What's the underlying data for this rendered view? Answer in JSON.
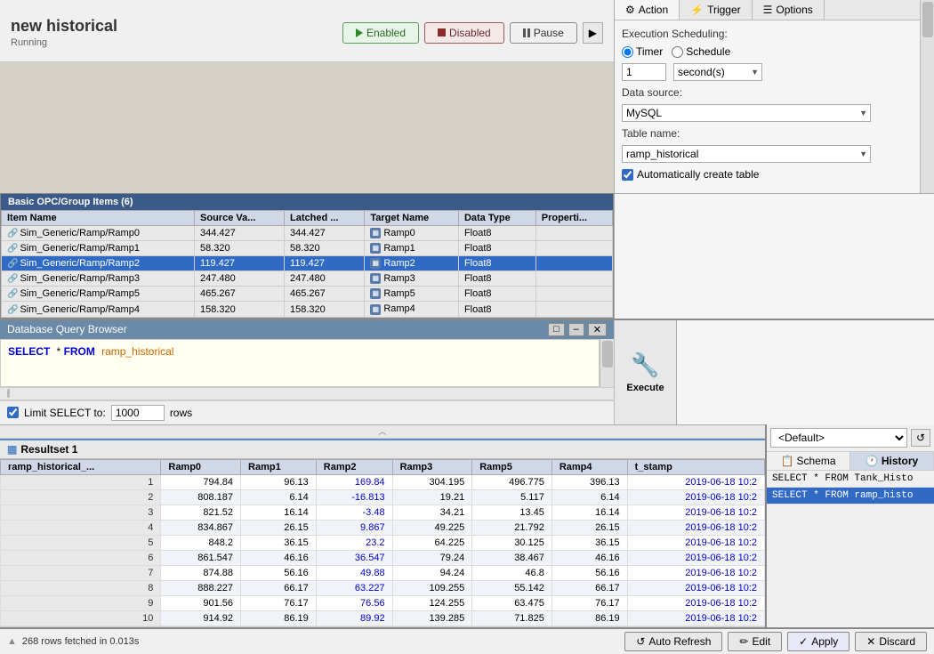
{
  "app": {
    "title": "new historical",
    "subtitle": "Running"
  },
  "toolbar": {
    "enabled_label": "Enabled",
    "disabled_label": "Disabled",
    "pause_label": "Pause",
    "arrow_btn_label": "▶"
  },
  "tabs": {
    "action": "Action",
    "trigger": "Trigger",
    "options": "Options"
  },
  "config": {
    "execution_label": "Execution Scheduling:",
    "timer_label": "Timer",
    "schedule_label": "Schedule",
    "timer_value": "1",
    "timer_unit": "second(s)",
    "datasource_label": "Data source:",
    "datasource_value": "MySQL",
    "tablename_label": "Table name:",
    "tablename_value": "ramp_historical",
    "autocreate_label": "Automatically create table"
  },
  "opc": {
    "header": "Basic OPC/Group Items (6)",
    "columns": [
      "Item Name",
      "Source Va...",
      "Latched ...",
      "Target Name",
      "Data Type",
      "Properti..."
    ],
    "rows": [
      {
        "name": "Sim_Generic/Ramp/Ramp0",
        "source": "344.427",
        "latched": "344.427",
        "target": "Ramp0",
        "dtype": "Float8",
        "props": "",
        "selected": false
      },
      {
        "name": "Sim_Generic/Ramp/Ramp1",
        "source": "58.320",
        "latched": "58.320",
        "target": "Ramp1",
        "dtype": "Float8",
        "props": "",
        "selected": false
      },
      {
        "name": "Sim_Generic/Ramp/Ramp2",
        "source": "119.427",
        "latched": "119.427",
        "target": "Ramp2",
        "dtype": "Float8",
        "props": "",
        "selected": true
      },
      {
        "name": "Sim_Generic/Ramp/Ramp3",
        "source": "247.480",
        "latched": "247.480",
        "target": "Ramp3",
        "dtype": "Float8",
        "props": "",
        "selected": false
      },
      {
        "name": "Sim_Generic/Ramp/Ramp5",
        "source": "465.267",
        "latched": "465.267",
        "target": "Ramp5",
        "dtype": "Float8",
        "props": "",
        "selected": false
      },
      {
        "name": "Sim_Generic/Ramp/Ramp4",
        "source": "158.320",
        "latched": "158.320",
        "target": "Ramp4",
        "dtype": "Float8",
        "props": "",
        "selected": false
      }
    ]
  },
  "db_browser": {
    "title": "Database Query Browser",
    "sql": "SELECT * FROM ramp_historical",
    "limit_label": "Limit SELECT to:",
    "limit_value": "1000",
    "rows_label": "rows"
  },
  "resultset": {
    "tab_label": "Resultset 1",
    "columns": [
      "ramp_historical_...",
      "Ramp0",
      "Ramp1",
      "Ramp2",
      "Ramp3",
      "Ramp5",
      "Ramp4",
      "t_stamp"
    ],
    "rows": [
      [
        1,
        "794.84",
        "96.13",
        "169.84",
        "304.195",
        "496.775",
        "396.13",
        "2019-06-18 10:2"
      ],
      [
        2,
        "808.187",
        "6.14",
        "-16.813",
        "19.21",
        "5.117",
        "6.14",
        "2019-06-18 10:2"
      ],
      [
        3,
        "821.52",
        "16.14",
        "-3.48",
        "34.21",
        "13.45",
        "16.14",
        "2019-06-18 10:2"
      ],
      [
        4,
        "834.867",
        "26.15",
        "9.867",
        "49.225",
        "21.792",
        "26.15",
        "2019-06-18 10:2"
      ],
      [
        5,
        "848.2",
        "36.15",
        "23.2",
        "64.225",
        "30.125",
        "36.15",
        "2019-06-18 10:2"
      ],
      [
        6,
        "861.547",
        "46.16",
        "36.547",
        "79.24",
        "38.467",
        "46.16",
        "2019-06-18 10:2"
      ],
      [
        7,
        "874.88",
        "56.16",
        "49.88",
        "94.24",
        "46.8",
        "56.16",
        "2019-06-18 10:2"
      ],
      [
        8,
        "888.227",
        "66.17",
        "63.227",
        "109.255",
        "55.142",
        "66.17",
        "2019-06-18 10:2"
      ],
      [
        9,
        "901.56",
        "76.17",
        "76.56",
        "124.255",
        "63.475",
        "76.17",
        "2019-06-18 10:2"
      ],
      [
        10,
        "914.92",
        "86.19",
        "89.92",
        "139.285",
        "71.825",
        "86.19",
        "2019-06-18 10:2"
      ]
    ],
    "highlighted_col_indices": [
      4,
      8
    ]
  },
  "right_panel": {
    "dropdown_value": "<Default>",
    "schema_tab": "Schema",
    "history_tab": "History",
    "history_items": [
      {
        "text": "SELECT * FROM Tank_Histo",
        "active": false
      },
      {
        "text": "SELECT * FROM ramp_histo",
        "active": true
      }
    ]
  },
  "bottom": {
    "status": "268 rows fetched in 0.013s",
    "auto_refresh": "Auto Refresh",
    "edit": "Edit",
    "apply": "Apply",
    "discard": "Discard"
  },
  "execute": {
    "label": "Execute"
  }
}
